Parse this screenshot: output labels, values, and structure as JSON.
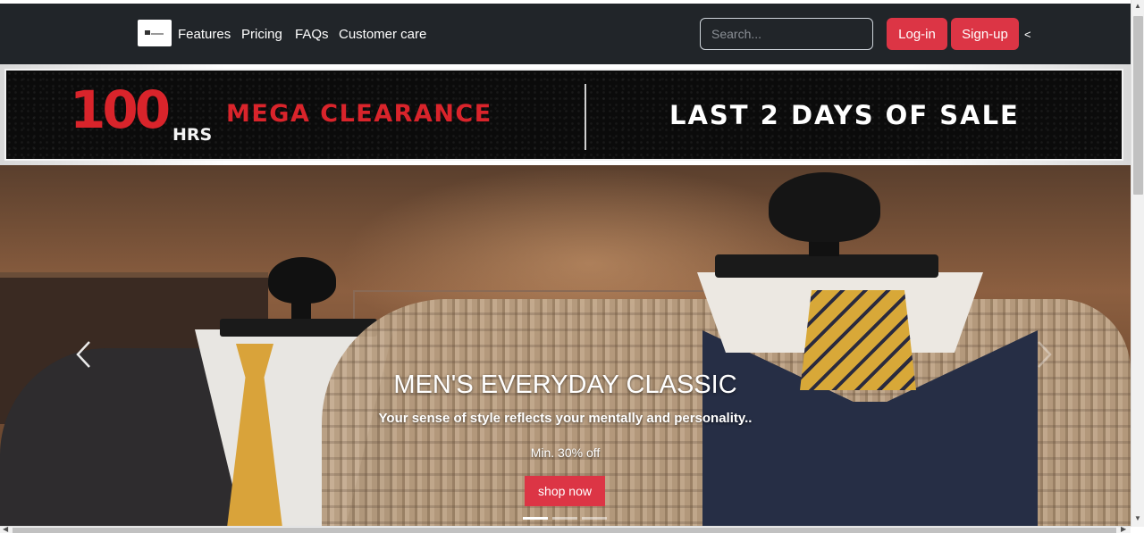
{
  "navbar": {
    "links": [
      "Features",
      "Pricing",
      "FAQs",
      "Customer care"
    ],
    "search_placeholder": "Search...",
    "login_label": "Log-in",
    "signup_label": "Sign-up",
    "caret": "<"
  },
  "banner": {
    "hours_number": "100",
    "hours_unit": "HRS",
    "left_text": "MEGA CLEARANCE",
    "right_text": "LAST 2 DAYS OF SALE"
  },
  "carousel": {
    "title": "MEN'S EVERYDAY CLASSIC",
    "subtitle": "Your sense of style reflects your mentally and personality..",
    "promo": "Min. 30% off",
    "cta_label": "shop now",
    "prev_icon": "chevron-left-icon",
    "next_icon": "chevron-right-icon",
    "slide_count": 3,
    "active_slide": 1
  },
  "colors": {
    "navbar_bg": "#212529",
    "accent": "#dc3545",
    "banner_red": "#d9242b"
  }
}
